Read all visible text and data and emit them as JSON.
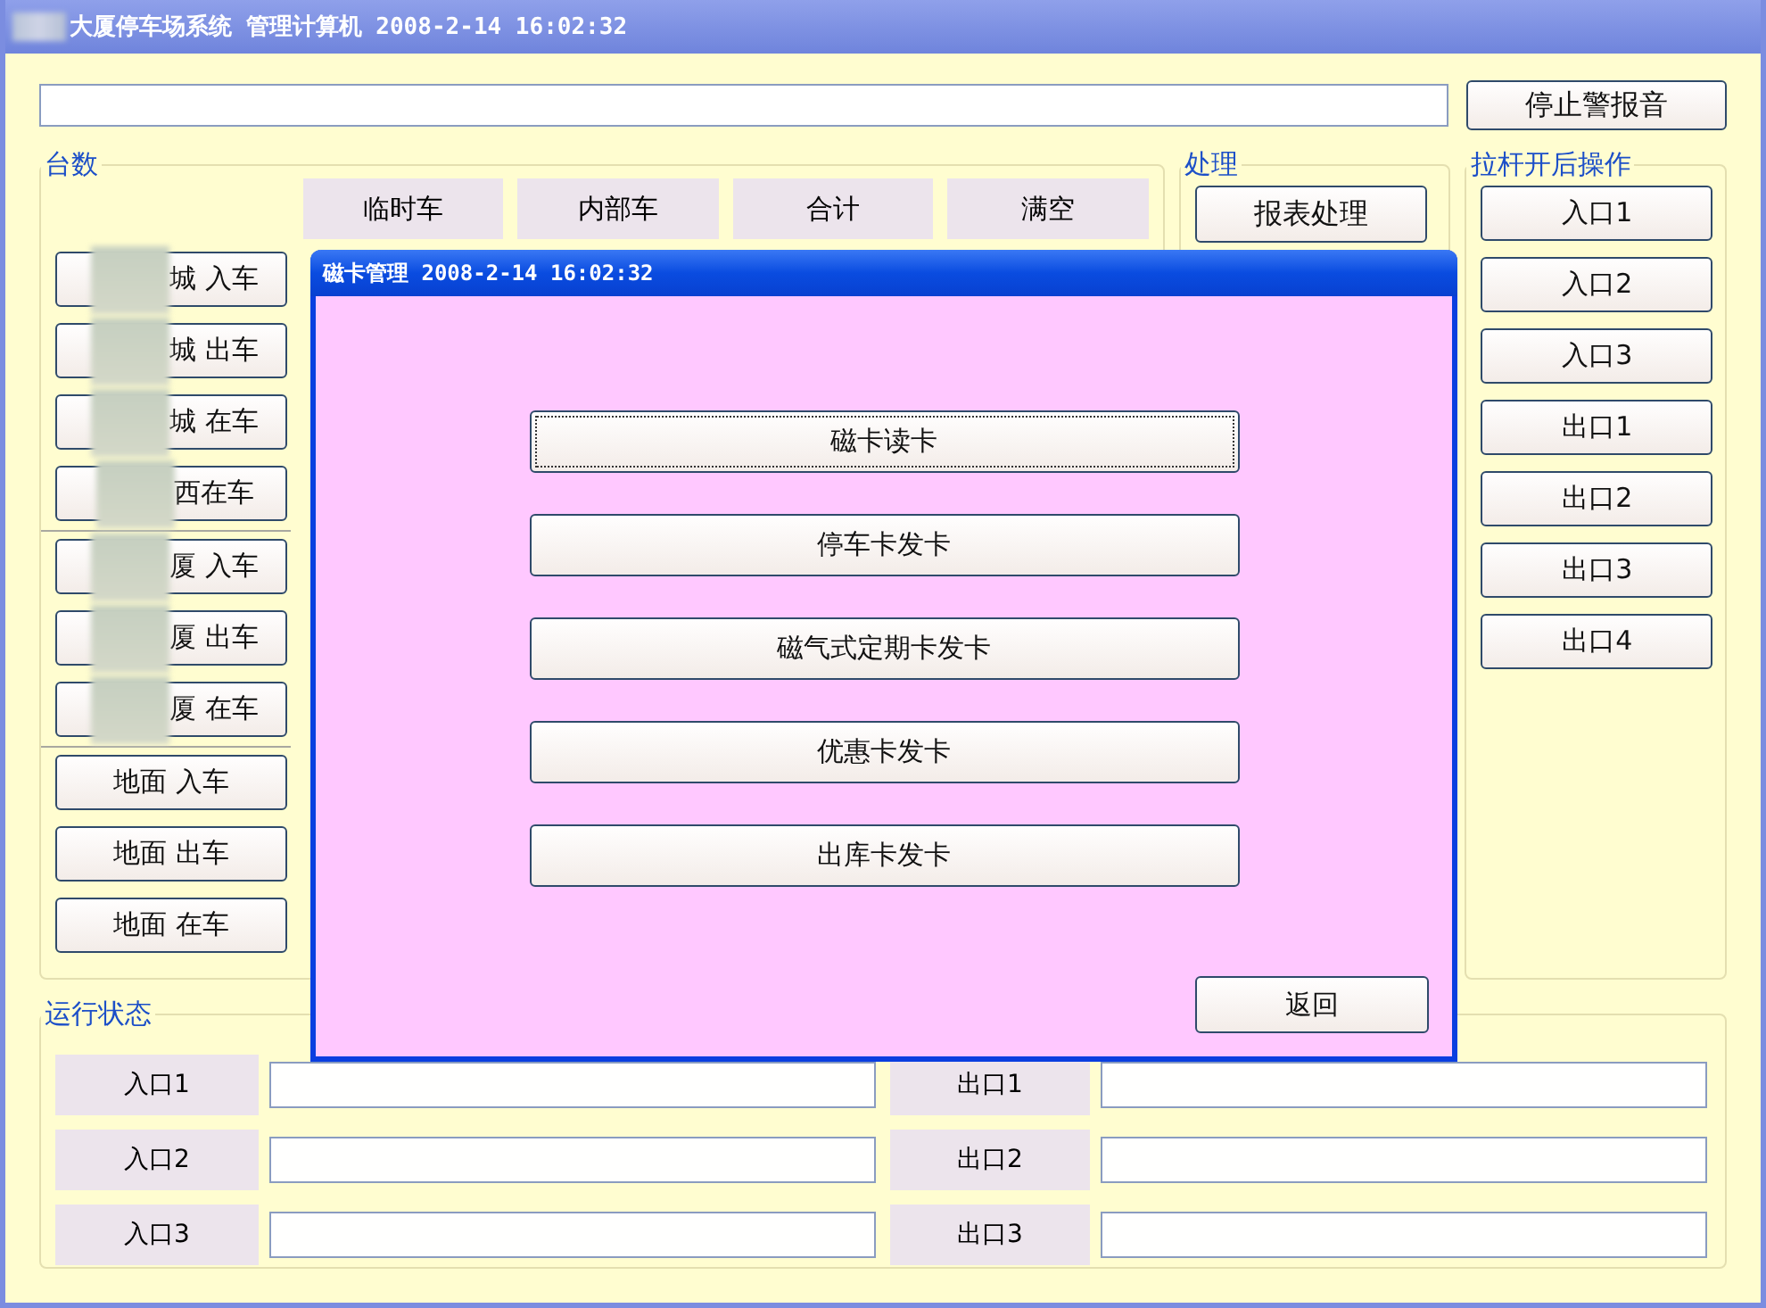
{
  "window": {
    "title": "大厦停车场系统 管理计算机 2008-2-14 16:02:32",
    "title_blurred": true
  },
  "stop_alarm_button": "停止警报音",
  "counts": {
    "title": "台数",
    "columns": [
      "临时车",
      "内部车",
      "合计",
      "满空"
    ],
    "button_groups": [
      [
        {
          "label": "城 入车",
          "blurred": true
        },
        {
          "label": "城 出车",
          "blurred": true
        },
        {
          "label": "城 在车",
          "blurred": true
        },
        {
          "label": "西在车",
          "blurred": true
        }
      ],
      [
        {
          "label": "厦 入车",
          "blurred": true
        },
        {
          "label": "厦 出车",
          "blurred": true
        },
        {
          "label": "厦 在车",
          "blurred": true
        }
      ],
      [
        {
          "label": "地面 入车",
          "blurred": false
        },
        {
          "label": "地面 出车",
          "blurred": false
        },
        {
          "label": "地面 在车",
          "blurred": false
        }
      ]
    ]
  },
  "processing": {
    "title": "处理",
    "buttons": [
      "报表处理"
    ]
  },
  "barrier": {
    "title": "拉杆开后操作",
    "buttons": [
      "入口1",
      "入口2",
      "入口3",
      "出口1",
      "出口2",
      "出口3",
      "出口4"
    ]
  },
  "status": {
    "title": "运行状态",
    "rows": [
      {
        "label": "入口1"
      },
      {
        "label": "出口1"
      },
      {
        "label": "入口2"
      },
      {
        "label": "出口2"
      },
      {
        "label": "入口3"
      },
      {
        "label": "出口3"
      }
    ]
  },
  "dialog": {
    "title": "磁卡管理 2008-2-14 16:02:32",
    "buttons": [
      {
        "label": "磁卡读卡",
        "focused": true
      },
      {
        "label": "停车卡发卡",
        "focused": false
      },
      {
        "label": "磁气式定期卡发卡",
        "focused": false
      },
      {
        "label": "优惠卡发卡",
        "focused": false
      },
      {
        "label": "出库卡发卡",
        "focused": false
      }
    ],
    "back_button": "返回"
  }
}
